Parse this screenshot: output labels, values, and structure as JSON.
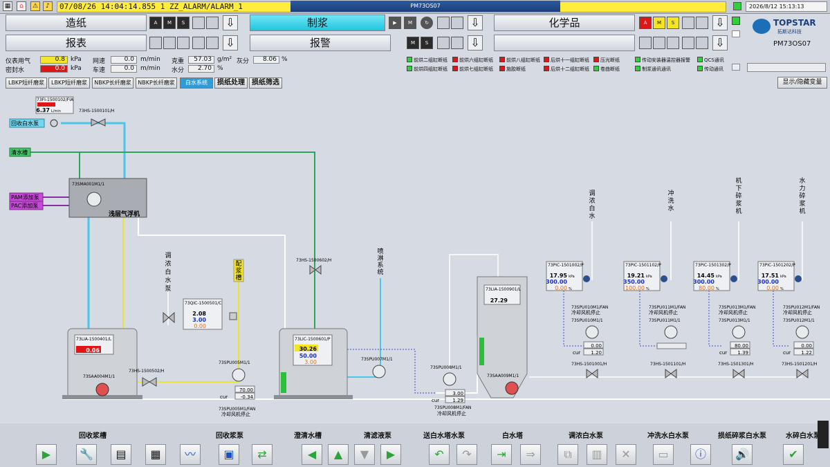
{
  "topbar": {
    "alarm_text": "07/08/26   14:04:14.855    1    ZZ_ALARM/ALARM_1",
    "window_title": "PM73OS07",
    "clock": "2026/8/12 15:13:13"
  },
  "nav": {
    "row1": [
      "造纸",
      "制浆",
      "化学品"
    ],
    "row2": [
      "报表",
      "报警"
    ],
    "mode_letters": [
      "A",
      "M",
      "S"
    ],
    "down_arrow": "⇩"
  },
  "brand": {
    "name": "TOPSTAR",
    "sub": "拓斯达科技",
    "machine": "PM73OS07"
  },
  "indicators": {
    "instrument_air": {
      "label": "仪表用气",
      "value": "0.8",
      "unit": "kPa"
    },
    "seal_water": {
      "label": "密封水",
      "value": "0.0",
      "unit": "kPa"
    },
    "wire_speed": {
      "label": "网速",
      "value": "0.0",
      "unit": "m/min"
    },
    "reel_speed": {
      "label": "车速",
      "value": "0.0",
      "unit": "m/min"
    },
    "gram": {
      "label": "克重",
      "value": "57.03",
      "unit": "g/m²"
    },
    "ash": {
      "label": "灰分",
      "value": "8.06",
      "unit": "%"
    },
    "moisture": {
      "label": "水分",
      "value": "2.70",
      "unit": "%"
    }
  },
  "legend": [
    {
      "text": "前烘二组缸断纸",
      "color": "#2fd03a"
    },
    {
      "text": "前烘六组缸断纸",
      "color": "#e01616"
    },
    {
      "text": "前烘八组缸断纸",
      "color": "#e01616"
    },
    {
      "text": "后烘十一组缸断纸",
      "color": "#e01616"
    },
    {
      "text": "压光断纸",
      "color": "#e01616"
    },
    {
      "text": "传动安装器温控器报警",
      "color": "#2fd03a"
    },
    {
      "text": "QCS通讯",
      "color": "#2fd03a"
    },
    {
      "text": "前烘四组缸断纸",
      "color": "#2fd03a"
    },
    {
      "text": "前烘七组缸断纸",
      "color": "#e01616"
    },
    {
      "text": "施胶断纸",
      "color": "#e01616"
    },
    {
      "text": "后烘十二组缸断纸",
      "color": "#e01616"
    },
    {
      "text": "卷曲断纸",
      "color": "#2fd03a"
    },
    {
      "text": "制浆通讯通讯",
      "color": "#2fd03a"
    },
    {
      "text": "传动通讯",
      "color": "#2fd03a"
    }
  ],
  "tabs": [
    "LBKP短纤磨浆",
    "LBKP短纤磨浆",
    "NBKP长纤磨浆",
    "NBKP长纤磨浆",
    "白水系统",
    "损纸处理",
    "损纸筛选"
  ],
  "toggle_label": "显示/隐藏变量",
  "diagram": {
    "fia_tag": "73FI-1500102/FIA",
    "fia_val": "6.37",
    "fia_unit": "L/min",
    "hs_top_tag": "73HS-1500101/H",
    "pump_recover": "回收白水泵",
    "clear_water": "清水槽",
    "pam": "PAM添加泵",
    "pac": "PAC添加泵",
    "daf_tag": "73SMA001M1/1",
    "daf_name": "浅层气浮机",
    "tank1_tag": "73LIA-1500401/L",
    "tank1_val": "0.06",
    "tank1_agit": "73SAA004M1/1",
    "hs2_tag": "73HS-1500502/H",
    "dilute_label": [
      "调",
      "浓",
      "白",
      "水",
      "泵"
    ],
    "qic_tag": "73QIC-1500501/C",
    "qic_vals": [
      "2.08",
      "3.00",
      "0.00"
    ],
    "pulp_tank": [
      "配",
      "浆",
      "槽"
    ],
    "pump2_tag": "73SPU005M1/1",
    "pump2_vals": [
      "70.00",
      "-0.34"
    ],
    "pump2_fan": "73SPU005M1/FAN",
    "pump2_fan_stop": "冷却风机停止",
    "hs3_tag": "73HS-1500602/H",
    "lic_tag": "73LIC-1500601/P",
    "lic_vals": [
      "30.26",
      "50.00",
      "3.00"
    ],
    "spray_label": [
      "喷",
      "淋",
      "系",
      "统"
    ],
    "pump3_tag": "73SPU007M1/1",
    "pump4_tag": "73SPU008M1/1",
    "pump4_vals": [
      "3.00",
      "1.29"
    ],
    "pump4_fan": "73SPU008M1/FAN",
    "tower_tag": "73LIA-1500901/L",
    "tower_val": "27.29",
    "tower_agit": "73SAA009M1/1",
    "branches": [
      {
        "label": [
          "调",
          "浓",
          "白",
          "水"
        ],
        "pic": "73PIC-1501002/P",
        "vals": [
          "17.95",
          "300.00",
          "0.00"
        ],
        "fan": "73SPU010M1/FAN",
        "fan_stop": "冷却风机停止",
        "pump": "73SPU010M1/1",
        "set": [
          "0.00",
          "1.20"
        ],
        "hs": "73HS-1501001/H"
      },
      {
        "label": [
          "冲",
          "洗",
          "水"
        ],
        "pic": "73PIC-1501102/P",
        "vals": [
          "19.21",
          "350.00",
          "100.00"
        ],
        "fan": "73SPU011M1/FAN",
        "fan_stop": "冷却风机停止",
        "pump": "73SPU011M1/1",
        "set": [
          "",
          ""
        ],
        "hs": "73HS-1501101/H"
      },
      {
        "label": [
          "机",
          "下",
          "碎",
          "浆",
          "机"
        ],
        "pic": "73PIC-1501302/P",
        "vals": [
          "14.45",
          "300.00",
          "80.00"
        ],
        "fan": "73SPU013M1/FAN",
        "fan_stop": "冷却风机停止",
        "pump": "73SPU013M1/1",
        "set": [
          "80.00",
          "1.39"
        ],
        "hs": "73HS-1501301/H"
      },
      {
        "label": [
          "水",
          "力",
          "碎",
          "浆",
          "机"
        ],
        "pic": "73PIC-1501202/P",
        "vals": [
          "17.51",
          "300.00",
          "0.00"
        ],
        "fan": "73SPU012M1/FAN",
        "fan_stop": "冷却风机停止",
        "pump": "73SPU012M1/1",
        "set": [
          "0.00",
          "1.22"
        ],
        "hs": "73HS-1501201/H"
      }
    ],
    "cur": "cur",
    "unit_kpa": "kPa",
    "unit_pct": "%"
  },
  "bottom_labels": [
    "回收浆槽",
    "回收浆泵",
    "澄清水槽",
    "清滤液泵",
    "送白水塔水泵",
    "白水塔",
    "调浓白水泵",
    "冲洗水白水泵",
    "损纸碎浆白水泵",
    "水碎白水泵"
  ],
  "colors": {
    "pipe_cyan": "#4ac6ea",
    "pipe_green": "#2aa55a",
    "pipe_yellow": "#e8e23a",
    "pipe_purple": "#8a2ea8",
    "pipe_blue_dotted": "#3a4bd8"
  }
}
